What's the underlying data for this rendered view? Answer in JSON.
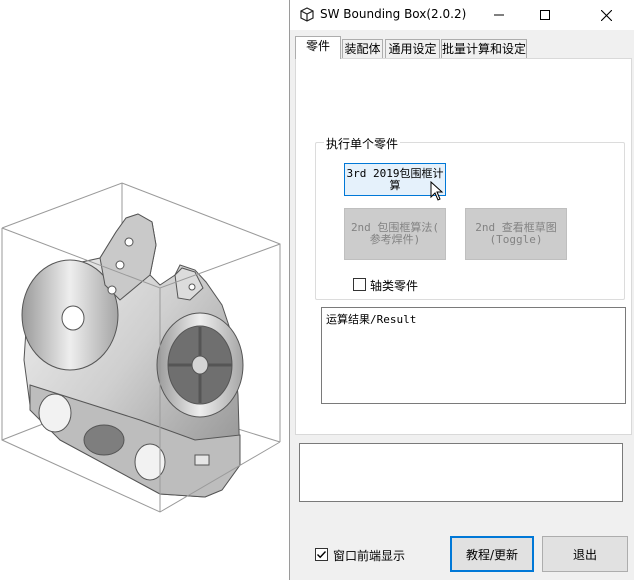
{
  "window": {
    "title": "SW Bounding Box(2.0.2)",
    "app_icon": "cube-outline-icon",
    "controls": [
      "minimize-icon",
      "maximize-icon",
      "close-icon"
    ]
  },
  "tabs": [
    {
      "label": "零件",
      "active": true
    },
    {
      "label": "装配体",
      "active": false
    },
    {
      "label": "通用设定",
      "active": false
    },
    {
      "label": "批量计算和设定",
      "active": false
    }
  ],
  "part_tab": {
    "group_label": "执行单个零件",
    "btn_3rd_line1": "3rd 2019包围框计",
    "btn_3rd_line2": "算",
    "btn_2nd_ref_line1": "2nd 包围框算法(",
    "btn_2nd_ref_line2": "参考焊件)",
    "btn_2nd_sketch_line1": "2nd 查看框草图",
    "btn_2nd_sketch_line2": "(Toggle)",
    "shaft_checkbox_label": "轴类零件",
    "shaft_checked": false,
    "result_text": "运算结果/Result"
  },
  "footer": {
    "front_checkbox_label": "窗口前端显示",
    "front_checked": true,
    "tutorial_button": "教程/更新",
    "exit_button": "退出"
  },
  "colors": {
    "accent": "#0078d7",
    "disabled_button": "#cccccc",
    "disabled_text": "#838383",
    "dialog_bg": "#f0f0f0"
  }
}
